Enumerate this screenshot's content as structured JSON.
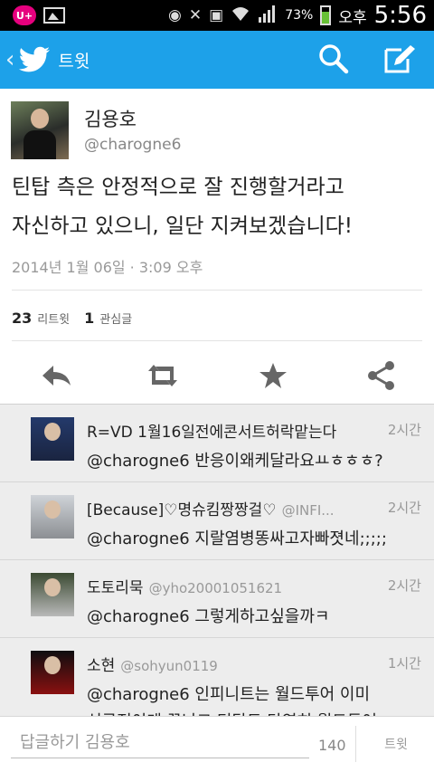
{
  "status_bar": {
    "carrier_badge": "U+",
    "icons": [
      "gallery-icon",
      "eye-icon",
      "mute-icon",
      "screenshot-icon",
      "wifi-icon",
      "signal-icon"
    ],
    "battery_percent": "73%",
    "ampm": "오후",
    "time": "5:56",
    "colors": {
      "battery": "#67c036",
      "carrier": "#e6007e"
    }
  },
  "action_bar": {
    "title": "트윗",
    "color": "#1da1e9",
    "icons": [
      "back-chevron-icon",
      "twitter-bird-icon",
      "search-icon",
      "compose-icon"
    ]
  },
  "tweet": {
    "author_name": "김용호",
    "author_handle": "@charogne6",
    "text_line1": "틴탑 측은 안정적으로 잘 진행할거라고",
    "text_line2": "자신하고 있으니, 일단 지켜보겠습니다!",
    "date": "2014년 1월 06일 · 3:09 오후",
    "retweet_count": "23",
    "retweet_label": "리트윗",
    "favorite_count": "1",
    "favorite_label": "관심글",
    "action_icons": [
      "reply-icon",
      "retweet-icon",
      "favorite-star-icon",
      "share-icon"
    ]
  },
  "replies": [
    {
      "name": "R=VD 1월16일전에콘서트허락맡는다",
      "handle": "",
      "time": "2시간",
      "text": "@charogne6 반응이왜케달라요ㅛㅎㅎㅎ?"
    },
    {
      "name": "[Because]♡명슈킴짱짱걸♡",
      "handle": "@INFI...",
      "time": "2시간",
      "text": "@charogne6 지랄염병똥싸고자빠졋네;;;;;"
    },
    {
      "name": "도토리묵",
      "handle": "@yho20001051621",
      "time": "2시간",
      "text": "@charogne6 그렇게하고싶을까ㅋ"
    },
    {
      "name": "소현",
      "handle": "@sohyun0119",
      "time": "1시간",
      "text_line1": "@charogne6 인피니트는 월드투어 이미",
      "text_line2": "성공적이게 끝났고 틴탑도 당연히 월드투어"
    }
  ],
  "reply_bar": {
    "placeholder": "답글하기 김용호",
    "char_count": "140",
    "tweet_button": "트윗"
  }
}
